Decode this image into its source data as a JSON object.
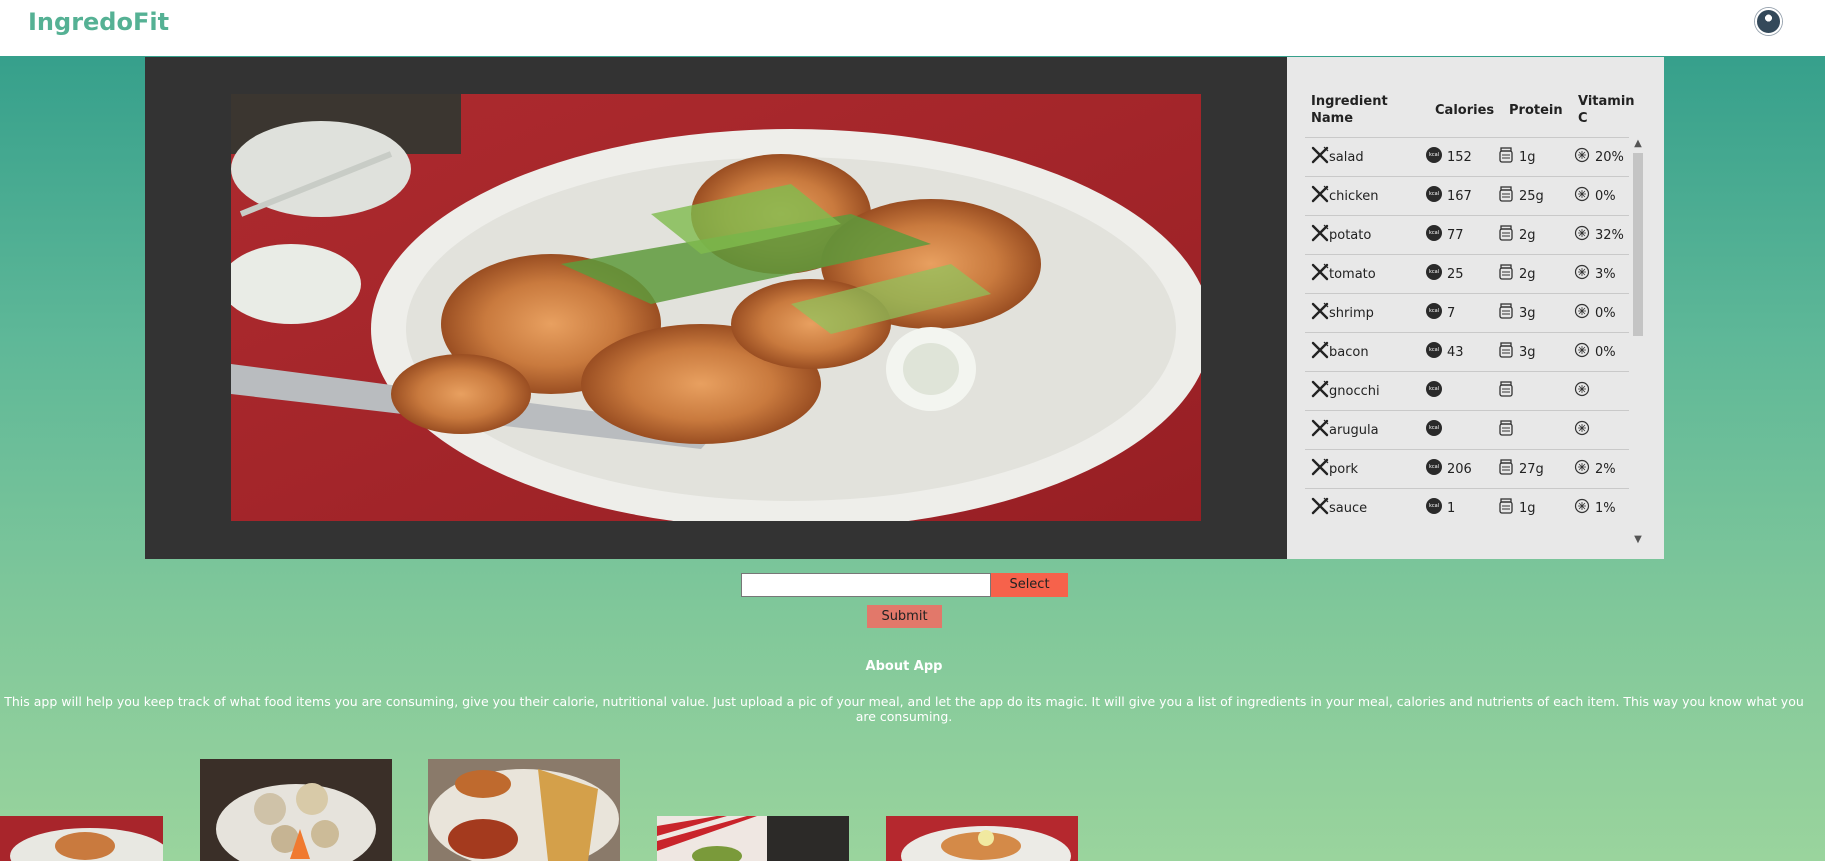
{
  "header": {
    "brand": "IngredoFit"
  },
  "table": {
    "headers": {
      "name": "Ingredient Name",
      "calories": "Calories",
      "protein": "Protein",
      "vitamin_c": "Vitamin C"
    },
    "rows": [
      {
        "name": "salad",
        "calories": "152",
        "protein": "1g",
        "vitamin_c": "20%"
      },
      {
        "name": "chicken",
        "calories": "167",
        "protein": "25g",
        "vitamin_c": "0%"
      },
      {
        "name": "potato",
        "calories": "77",
        "protein": "2g",
        "vitamin_c": "32%"
      },
      {
        "name": "tomato",
        "calories": "25",
        "protein": "2g",
        "vitamin_c": "3%"
      },
      {
        "name": "shrimp",
        "calories": "7",
        "protein": "3g",
        "vitamin_c": "0%"
      },
      {
        "name": "bacon",
        "calories": "43",
        "protein": "3g",
        "vitamin_c": "0%"
      },
      {
        "name": "gnocchi",
        "calories": "",
        "protein": "",
        "vitamin_c": ""
      },
      {
        "name": "arugula",
        "calories": "",
        "protein": "",
        "vitamin_c": ""
      },
      {
        "name": "pork",
        "calories": "206",
        "protein": "27g",
        "vitamin_c": "2%"
      },
      {
        "name": "sauce",
        "calories": "1",
        "protein": "1g",
        "vitamin_c": "1%"
      }
    ],
    "kcal_icon_label": "kcal"
  },
  "upload": {
    "select_label": "Select",
    "submit_label": "Submit",
    "file_value": ""
  },
  "about": {
    "title": "About App",
    "text": "This app will help you keep track of what food items you are consuming, give you their calorie, nutritional value. Just upload a pic of your meal, and let the app do its magic. It will give you a list of ingredients in your meal, calories and nutrients of each item. This way you know what you are consuming."
  },
  "colors": {
    "brand": "#55b194",
    "select_button": "#f6624b",
    "submit_button": "#e2786a",
    "panel_dark": "#333333",
    "panel_light": "#e8e8e8"
  }
}
